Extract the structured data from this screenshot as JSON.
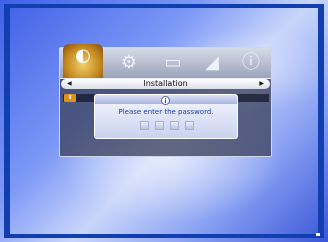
{
  "menu": {
    "title": "Installation",
    "tabs": [
      {
        "name": "installation",
        "icon": "satellite-dish-icon",
        "active": true
      },
      {
        "name": "settings",
        "icon": "gear-icon"
      },
      {
        "name": "tv-setup",
        "icon": "tv-icon"
      },
      {
        "name": "picture",
        "icon": "picture-icon"
      },
      {
        "name": "information",
        "icon": "info-icon"
      }
    ]
  },
  "dialog": {
    "message": "Please enter the password.",
    "password_digits": 4
  },
  "colors": {
    "frame": "#123fb0",
    "accent_orange": "#e09018",
    "dialog_text": "#1c3aa8"
  }
}
